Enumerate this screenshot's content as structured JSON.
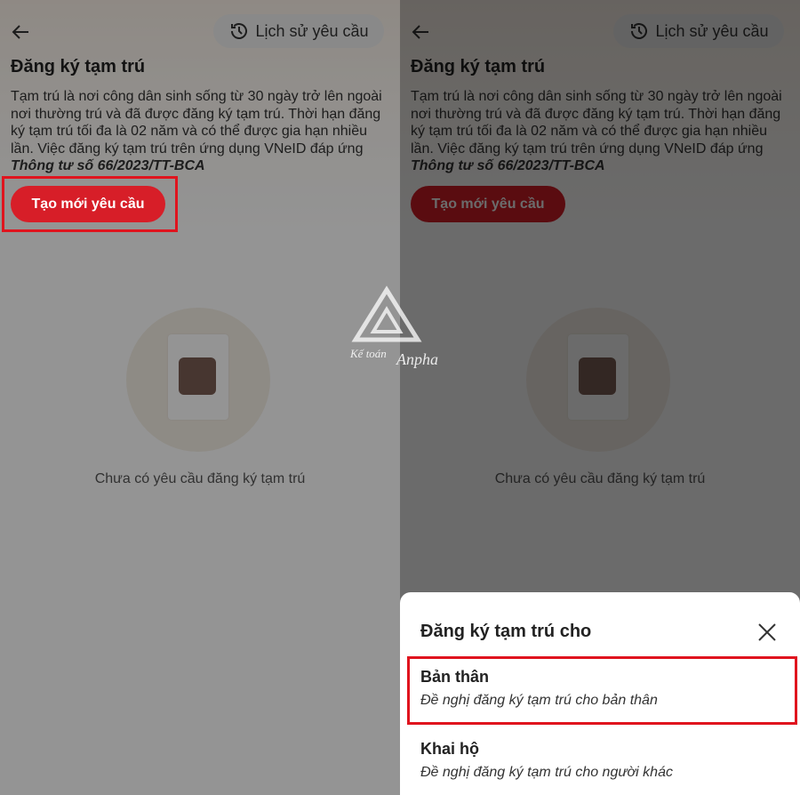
{
  "screen": {
    "history_label": "Lịch sử yêu cầu",
    "title": "Đăng ký tạm trú",
    "description_plain": "Tạm trú là nơi công dân sinh sống từ 30 ngày trở lên ngoài nơi thường trú và đã được đăng ký tạm trú. Thời hạn đăng ký tạm trú tối đa là 02 năm và có thể được gia hạn nhiều lần. Việc đăng ký tạm trú trên ứng dụng VNeID đáp ứng ",
    "description_bold": "Thông tư số 66/2023/TT-BCA",
    "create_button": "Tạo mới yêu cầu",
    "empty_text": "Chưa có yêu cầu đăng ký tạm trú"
  },
  "sheet": {
    "title": "Đăng ký tạm trú cho",
    "options": [
      {
        "title": "Bản thân",
        "subtitle": "Đề nghị đăng ký tạm trú cho bản thân"
      },
      {
        "title": "Khai hộ",
        "subtitle": "Đề nghị đăng ký tạm trú cho người khác"
      }
    ]
  },
  "watermark": {
    "text1": "Kế toán",
    "text2": "Anpha"
  },
  "colors": {
    "accent": "#d71e28",
    "highlight_box": "#e0141e"
  },
  "icons": {
    "back": "back-arrow-icon",
    "history": "clock-history-icon",
    "close": "close-icon",
    "avatar": "person-icon"
  }
}
